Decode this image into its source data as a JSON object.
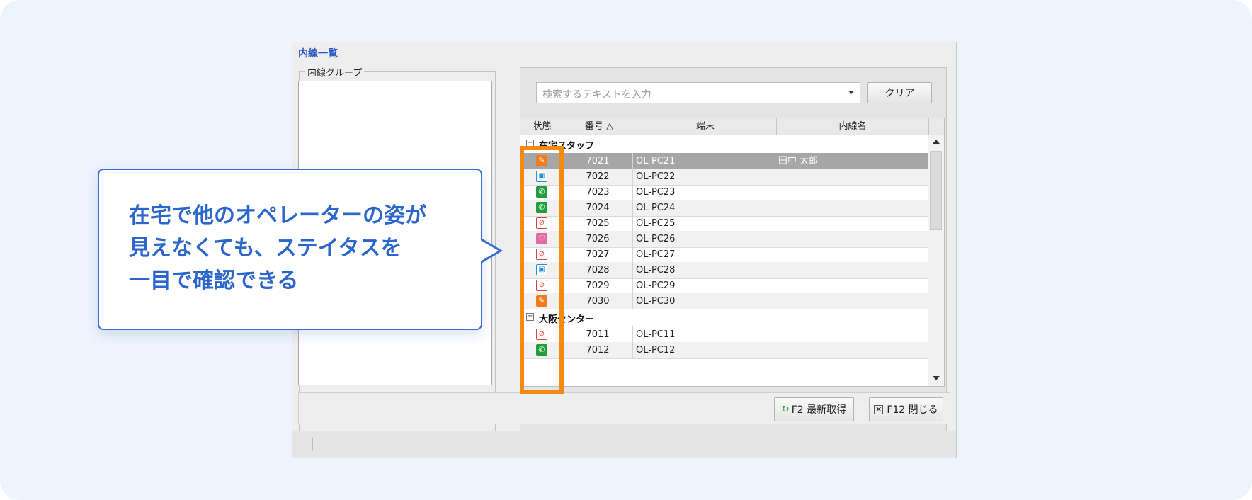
{
  "window": {
    "title": "内線一覧"
  },
  "left_group": {
    "label": "内線グループ"
  },
  "search": {
    "placeholder": "検索するテキストを入力",
    "clear_label": "クリア"
  },
  "grid": {
    "columns": [
      "状態",
      "番号 △",
      "端末",
      "内線名"
    ],
    "groups": [
      {
        "name": "在宅スタッフ",
        "rows": [
          {
            "status": "memo",
            "number": "7021",
            "terminal": "OL-PC21",
            "name": "田中 太郎",
            "selected": true
          },
          {
            "status": "meeting",
            "number": "7022",
            "terminal": "OL-PC22",
            "name": ""
          },
          {
            "status": "call",
            "number": "7023",
            "terminal": "OL-PC23",
            "name": ""
          },
          {
            "status": "call",
            "number": "7024",
            "terminal": "OL-PC24",
            "name": ""
          },
          {
            "status": "busy",
            "number": "7025",
            "terminal": "OL-PC25",
            "name": ""
          },
          {
            "status": "away",
            "number": "7026",
            "terminal": "OL-PC26",
            "name": ""
          },
          {
            "status": "busy",
            "number": "7027",
            "terminal": "OL-PC27",
            "name": ""
          },
          {
            "status": "meeting",
            "number": "7028",
            "terminal": "OL-PC28",
            "name": ""
          },
          {
            "status": "busy",
            "number": "7029",
            "terminal": "OL-PC29",
            "name": ""
          },
          {
            "status": "memo",
            "number": "7030",
            "terminal": "OL-PC30",
            "name": ""
          }
        ]
      },
      {
        "name": "大阪センター",
        "rows": [
          {
            "status": "busy",
            "number": "7011",
            "terminal": "OL-PC11",
            "name": ""
          },
          {
            "status": "call",
            "number": "7012",
            "terminal": "OL-PC12",
            "name": ""
          }
        ]
      }
    ]
  },
  "buttons": {
    "refresh_label": "F2 最新取得",
    "close_label": "F12 閉じる"
  },
  "callout": {
    "lines": [
      "在宅で他のオペレーターの姿が",
      "見えなくても、ステイタスを",
      "一目で確認できる"
    ]
  },
  "colors": {
    "highlight": "#f58a12",
    "callout_text": "#2b66cf",
    "title": "#2a56c6"
  }
}
